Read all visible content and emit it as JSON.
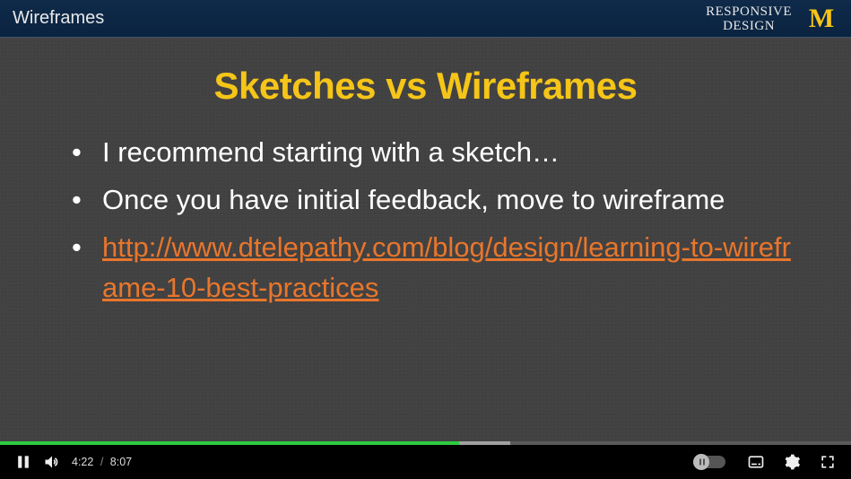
{
  "slide": {
    "header_left": "Wireframes",
    "course_line1": "RESPONSIVE",
    "course_line2": "DESIGN",
    "logo_letter": "M",
    "title": "Sketches vs Wireframes",
    "bullets": [
      "I recommend starting with a sketch…",
      "Once you have initial feedback, move to wireframe"
    ],
    "link_text": "http://www.dtelepathy.com/blog/design/learning-to-wireframe-10-best-practices"
  },
  "player": {
    "current_time": "4:22",
    "separator": "/",
    "duration": "8:07",
    "progress_percent": "54%"
  }
}
